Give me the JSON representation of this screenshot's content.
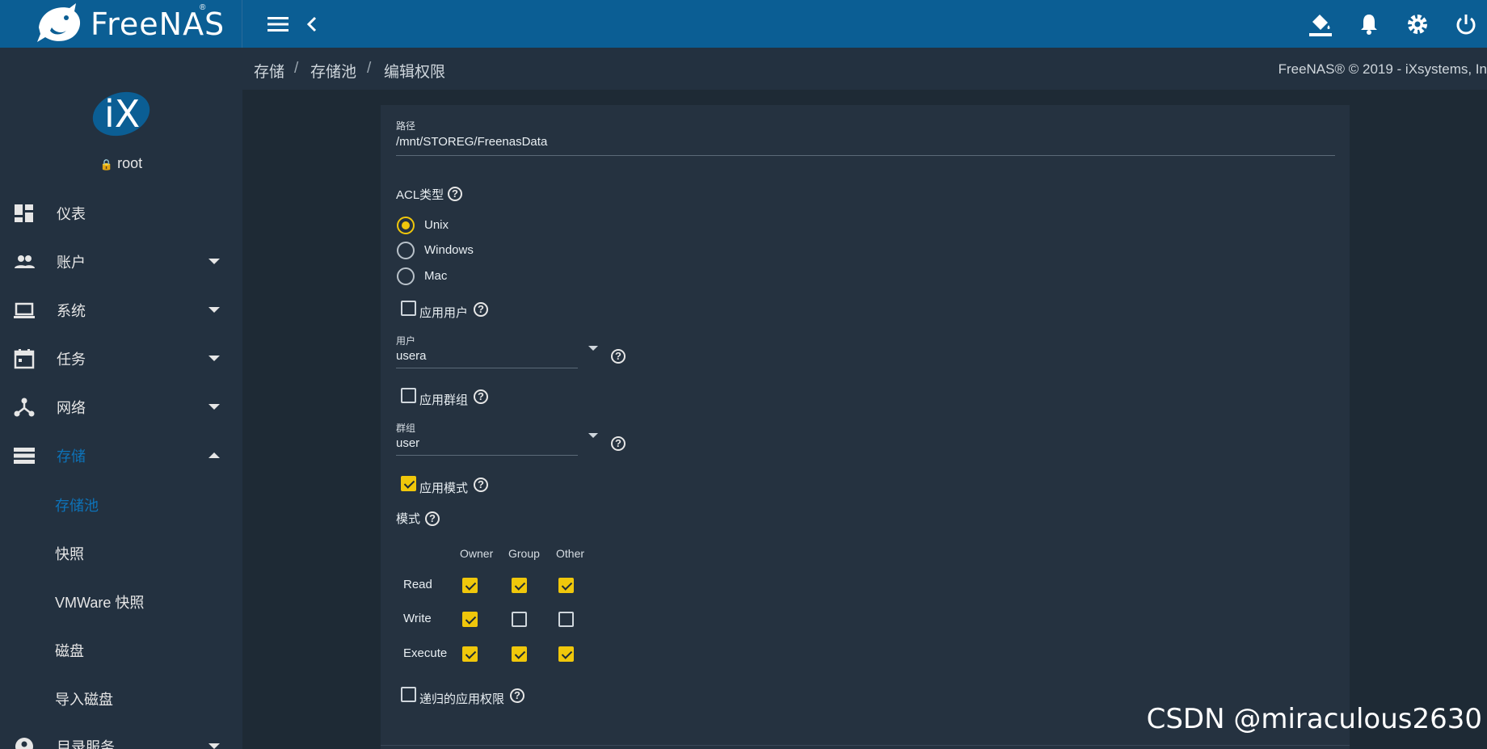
{
  "header": {
    "logo_text": "FreeNAS",
    "logo_reg": "®",
    "icons": [
      "menu-icon",
      "back-icon",
      "paint-bucket-icon",
      "bell-icon",
      "gear-icon",
      "power-icon"
    ]
  },
  "sidebar": {
    "user": "root",
    "items": [
      {
        "label": "仪表",
        "icon": "dashboard-icon"
      },
      {
        "label": "账户",
        "icon": "accounts-icon"
      },
      {
        "label": "系统",
        "icon": "laptop-icon"
      },
      {
        "label": "任务",
        "icon": "calendar-icon"
      },
      {
        "label": "网络",
        "icon": "network-icon"
      },
      {
        "label": "存储",
        "icon": "storage-icon"
      }
    ],
    "storage_sub": [
      "存储池",
      "快照",
      "VMWare 快照",
      "磁盘",
      "导入磁盘"
    ],
    "last_item": {
      "label": "目录服务",
      "icon": "directory-icon"
    },
    "accent": "#0d73b9"
  },
  "breadcrumb": {
    "items": [
      "存储",
      "存储池",
      "编辑权限"
    ],
    "sep": "/",
    "copyright": "FreeNAS® © 2019 - iXsystems, In"
  },
  "form": {
    "path_label": "路径",
    "path_value": "/mnt/STOREG/FreenasData",
    "acl_label": "ACL类型",
    "acl_options": [
      "Unix",
      "Windows",
      "Mac"
    ],
    "acl_selected": "Unix",
    "apply_user_label": "应用用户",
    "user_label": "用户",
    "user_value": "usera",
    "apply_group_label": "应用群组",
    "group_label": "群组",
    "group_value": "user",
    "apply_mode_label": "应用模式",
    "mode_label": "模式",
    "mode_columns": [
      "Owner",
      "Group",
      "Other"
    ],
    "mode_rows": [
      {
        "label": "Read",
        "values": [
          true,
          true,
          true
        ]
      },
      {
        "label": "Write",
        "values": [
          true,
          false,
          false
        ]
      },
      {
        "label": "Execute",
        "values": [
          true,
          true,
          true
        ]
      }
    ],
    "recursive_label": "递归的应用权限",
    "apply_user_checked": false,
    "apply_group_checked": false,
    "apply_mode_checked": true,
    "recursive_checked": false,
    "accent": "#f0c70b"
  },
  "watermark": "CSDN @miraculous2630"
}
